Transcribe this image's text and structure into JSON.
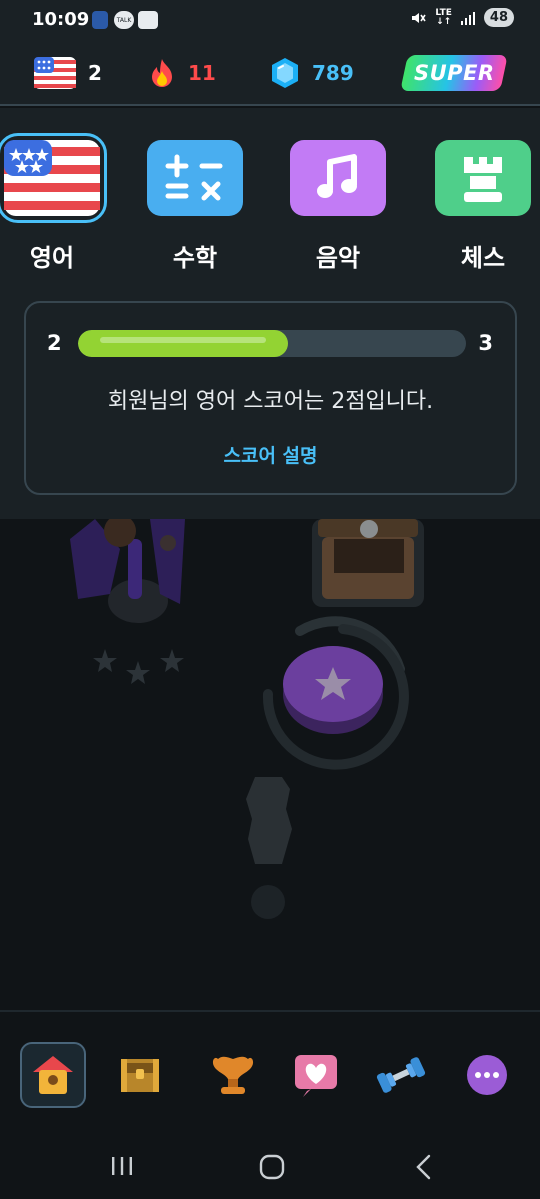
{
  "status_bar": {
    "time": "10:09",
    "network": "LTE",
    "battery": "48"
  },
  "header": {
    "courses_count": "2",
    "streak": "11",
    "gems": "789",
    "super_label": "SUPER"
  },
  "courses": [
    {
      "label": "영어",
      "icon": "us-flag-icon",
      "color": "#e8474c"
    },
    {
      "label": "수학",
      "icon": "math-symbols-icon",
      "color": "#49aef0"
    },
    {
      "label": "음악",
      "icon": "music-note-icon",
      "color": "#c27bf5"
    },
    {
      "label": "체스",
      "icon": "chess-rook-icon",
      "color": "#4fcf8a"
    }
  ],
  "score": {
    "current_level": "2",
    "next_level": "3",
    "progress": 0.54,
    "message": "회원님의 영어 스코어는 2점입니다.",
    "link": "스코어 설명"
  },
  "colors": {
    "accent_blue": "#49c0f8",
    "progress_green": "#93d333",
    "streak_red": "#ff4b4b",
    "gem_blue": "#49c0f8"
  },
  "bottom_nav": [
    "home-icon",
    "treasure-chest-icon",
    "trophy-icon",
    "heart-icon",
    "dumbbell-icon",
    "more-icon"
  ]
}
